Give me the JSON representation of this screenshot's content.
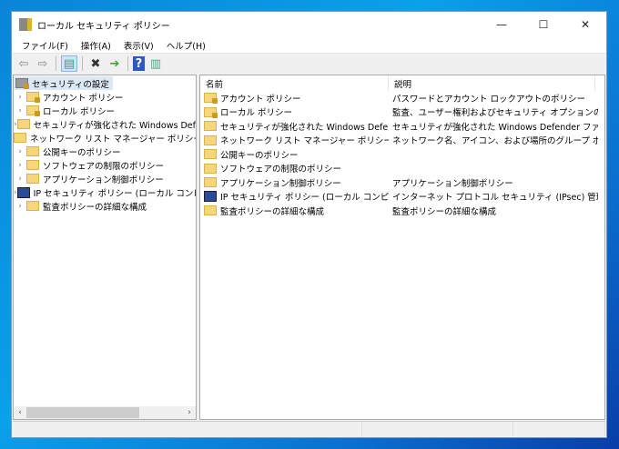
{
  "window": {
    "title": "ローカル セキュリティ ポリシー",
    "minimize": "—",
    "maximize": "☐",
    "close": "✕"
  },
  "menu": [
    "ファイル(F)",
    "操作(A)",
    "表示(V)",
    "ヘルプ(H)"
  ],
  "toolbar": {
    "back": "⇦",
    "forward": "⇨",
    "show_tree": "▤",
    "delete": "✖",
    "export": "➔",
    "help": "?",
    "view": "▥"
  },
  "tree": {
    "root": "セキュリティの設定",
    "items": [
      {
        "label": "アカウント ポリシー",
        "expandable": true,
        "icon": "lock-folder"
      },
      {
        "label": "ローカル ポリシー",
        "expandable": true,
        "icon": "lock-folder"
      },
      {
        "label": "セキュリティが強化された Windows Defender ファイアウォール",
        "expandable": true,
        "icon": "folder"
      },
      {
        "label": "ネットワーク リスト マネージャー ポリシー",
        "expandable": false,
        "icon": "folder"
      },
      {
        "label": "公開キーのポリシー",
        "expandable": true,
        "icon": "folder"
      },
      {
        "label": "ソフトウェアの制限のポリシー",
        "expandable": true,
        "icon": "folder"
      },
      {
        "label": "アプリケーション制御ポリシー",
        "expandable": true,
        "icon": "folder"
      },
      {
        "label": "IP セキュリティ ポリシー (ローカル コンピューター)",
        "expandable": true,
        "icon": "ip"
      },
      {
        "label": "監査ポリシーの詳細な構成",
        "expandable": true,
        "icon": "folder"
      }
    ]
  },
  "list": {
    "columns": [
      "名前",
      "説明"
    ],
    "rows": [
      {
        "name": "アカウント ポリシー",
        "desc": "パスワードとアカウント ロックアウトのポリシー"
      },
      {
        "name": "ローカル ポリシー",
        "desc": "監査、ユーザー権利およびセキュリティ オプションのポリ..."
      },
      {
        "name": "セキュリティが強化された Windows Defender...",
        "desc": "セキュリティが強化された Windows Defender ファイ..."
      },
      {
        "name": "ネットワーク リスト マネージャー ポリシー",
        "desc": "ネットワーク名、アイコン、および場所のグループ ポリシ..."
      },
      {
        "name": "公開キーのポリシー",
        "desc": ""
      },
      {
        "name": "ソフトウェアの制限のポリシー",
        "desc": ""
      },
      {
        "name": "アプリケーション制御ポリシー",
        "desc": "アプリケーション制御ポリシー"
      },
      {
        "name": "IP セキュリティ ポリシー (ローカル コンピューター)",
        "desc": "インターネット プロトコル セキュリティ (IPsec) 管理。ほ..."
      },
      {
        "name": "監査ポリシーの詳細な構成",
        "desc": "監査ポリシーの詳細な構成"
      }
    ]
  }
}
